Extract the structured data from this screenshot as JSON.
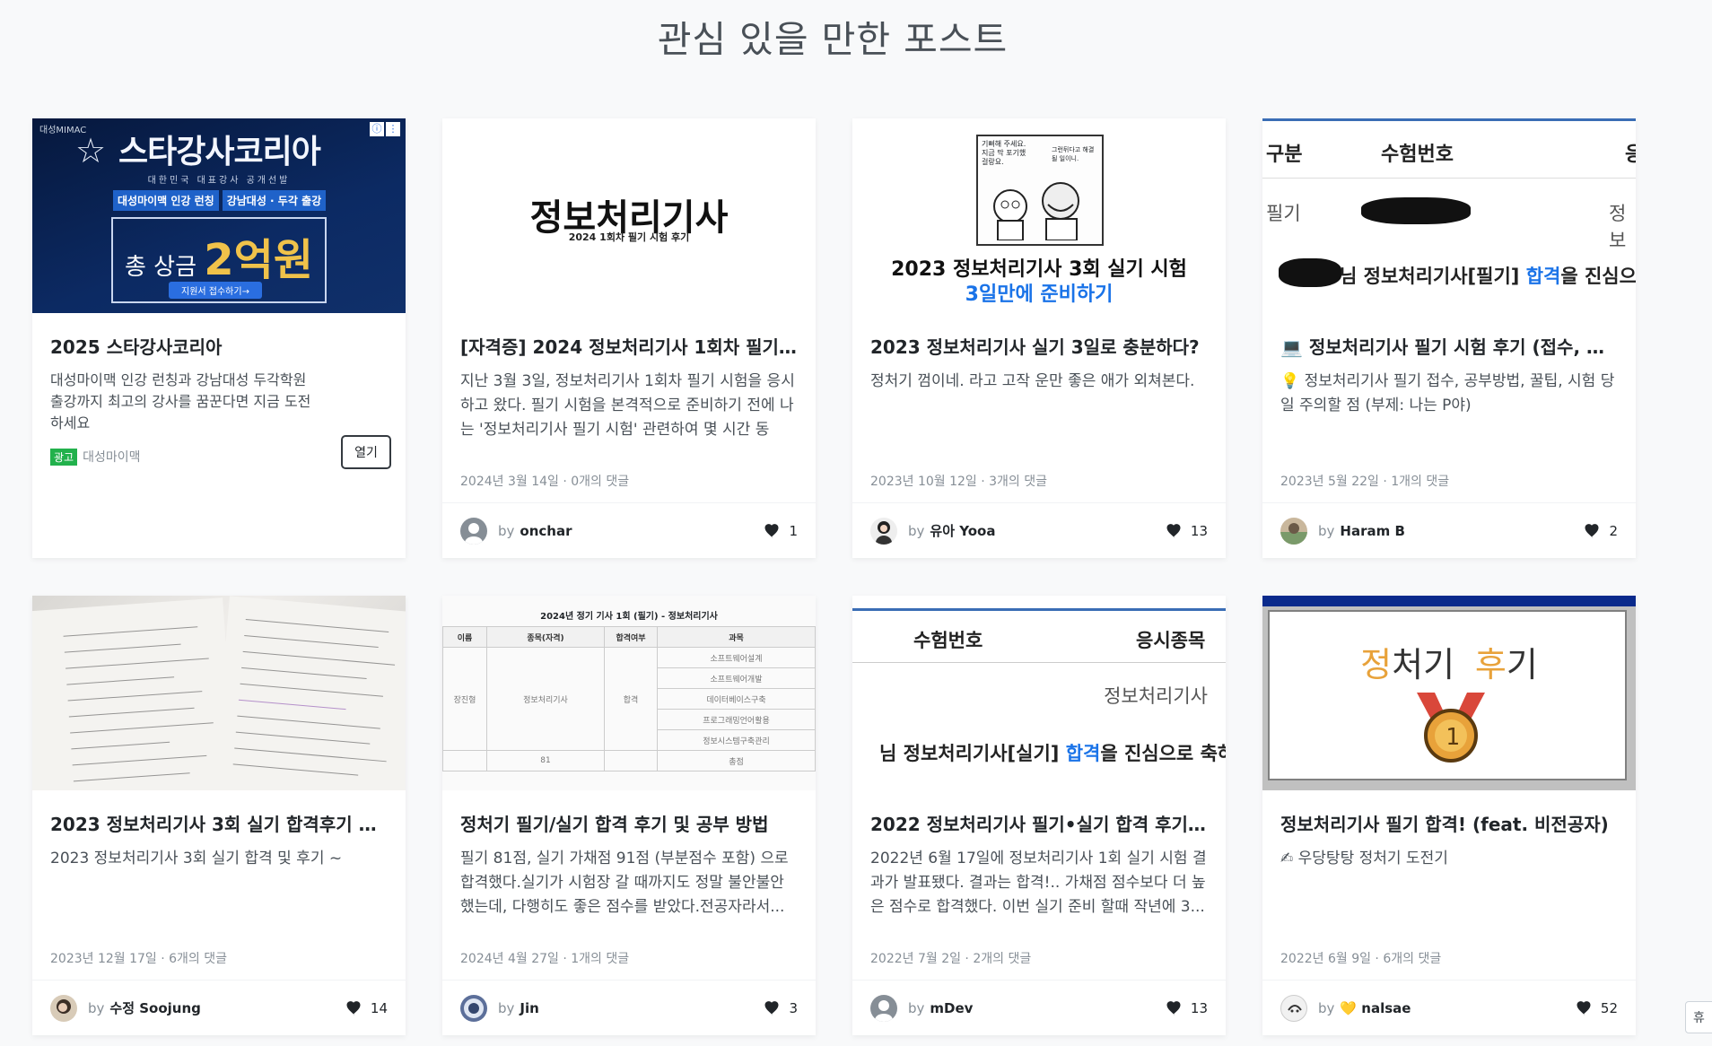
{
  "page": {
    "title": "관심 있을 만한 포스트"
  },
  "ad": {
    "brand": "대성MIMAC",
    "headline": "스타강사코리아",
    "sub": "대한민국 대표강사 공개선발",
    "tags": [
      "대성마이맥 인강 런칭",
      "강남대성 · 두각 출강"
    ],
    "prize_prefix": "총 상금",
    "prize_amount": "2억원",
    "apply": "지원서 접수하기→",
    "title": "2025 스타강사코리아",
    "desc": "대성마이맥 인강 런칭과 강남대성 두각학원 출강까지 최고의 강사를 꿈꾼다면 지금 도전하세요",
    "badge": "광고",
    "advertiser": "대성마이맥",
    "open": "열기"
  },
  "by_label": "by",
  "posts": [
    {
      "title": "[자격증] 2024 정보처리기사 1회차 필기 ...",
      "desc": "지난 3월 3일, 정보처리기사 1회차 필기 시험을 응시하고 왔다. 필기 시험을 본격적으로 준비하기 전에 나는 '정보처리기사 필기 시험' 관련하여 몇 시간 동안...",
      "meta": "2024년 3월 14일 · 0개의 댓글",
      "author": "onchar",
      "likes": "1",
      "thumb": {
        "title": "정보처리기사",
        "sub": "2024 1회차 필기 시험 후기"
      }
    },
    {
      "title": "2023 정보처리기사 실기 3일로 충분하다?",
      "desc": "정처기 껌이네. 라고 고작 운만 좋은 애가 외쳐본다.",
      "meta": "2023년 10월 12일 · 3개의 댓글",
      "author": "유아 Yooa",
      "likes": "13",
      "thumb": {
        "line1": "2023 정보처리기사 3회 실기 시험",
        "line2": "3일만에 준비하기",
        "bubble1": "기뻐해 주세요. 지금 막 포기했걸랑요.",
        "bubble2": "그런뒤다고 해결될 일이니."
      }
    },
    {
      "title": "💻 정보처리기사 필기 시험 후기 (접수, 공...",
      "desc": "💡 정보처리기사 필기 접수, 공부방법, 꿀팁, 시험 당일 주의할 점 (부제: 나는 P야)",
      "meta": "2023년 5월 22일 · 1개의 댓글",
      "author": "Haram B",
      "likes": "2",
      "thumb": {
        "h1": "구분",
        "h2": "수험번호",
        "h3": "응",
        "row1": "필기",
        "row2": "정보",
        "congrats_pre": "님 정보처리기사[필기] ",
        "congrats_hl": "합격",
        "congrats_post": "을 진심으로"
      }
    },
    {
      "title": "2023 정보처리기사 3회 실기 합격후기 및 ...",
      "desc": "2023 정보처리기사 3회 실기 합격 및 후기 ~",
      "meta": "2023년 12월 17일 · 6개의 댓글",
      "author": "수정 Soojung",
      "likes": "14"
    },
    {
      "title": "정처기 필기/실기 합격 후기 및 공부 방법",
      "desc": "필기 81점, 실기 가채점 91점 (부분점수 포함) 으로 합격했다.실기가 시험장 갈 때까지도 정말 불안불안했는데, 다행히도 좋은 점수를 받았다.전공자라서...",
      "meta": "2024년 4월 27일 · 1개의 댓글",
      "author": "Jin",
      "likes": "3",
      "thumb": {
        "caption": "2024년 정기 기사 1회 (필기) - 정보처리기사",
        "headers": [
          "이름",
          "종목(자격)",
          "합격여부",
          "과목"
        ],
        "name": "장진형",
        "field": "정보처리기사",
        "result": "합격",
        "subjects": [
          "소프트웨어설계",
          "소프트웨어개발",
          "데이터베이스구축",
          "프로그래밍언어활용",
          "정보시스템구축관리"
        ],
        "score": "81",
        "total": "총점"
      }
    },
    {
      "title": "2022 정보처리기사 필기•실기 합격 후기 +...",
      "desc": "2022년 6월 17일에 정보처리기사 1회 실기 시험 결과가 발표됐다. 결과는 합격!.. 가채점 점수보다 더 높은 점수로 합격했다. 이번 실기 준비 할때 작년에 3...",
      "meta": "2022년 7월 2일 · 2개의 댓글",
      "author": "mDev",
      "likes": "13",
      "thumb": {
        "h1": "수험번호",
        "h2": "응시종목",
        "field": "정보처리기사",
        "congrats_pre": "님 정보처리기사[실기] ",
        "congrats_hl": "합격",
        "congrats_post": "을 진심으로 축하드립"
      }
    },
    {
      "title": "정보처리기사 필기 합격! (feat. 비전공자)",
      "desc": "✍ 우당탕탕 정처기 도전기",
      "meta": "2022년 6월 9일 · 6개의 댓글",
      "author": "💛 nalsae",
      "likes": "52",
      "thumb": {
        "t1": "정",
        "t2": "처기 ",
        "t3": "후",
        "t4": "기"
      }
    }
  ],
  "side_button": "휴"
}
